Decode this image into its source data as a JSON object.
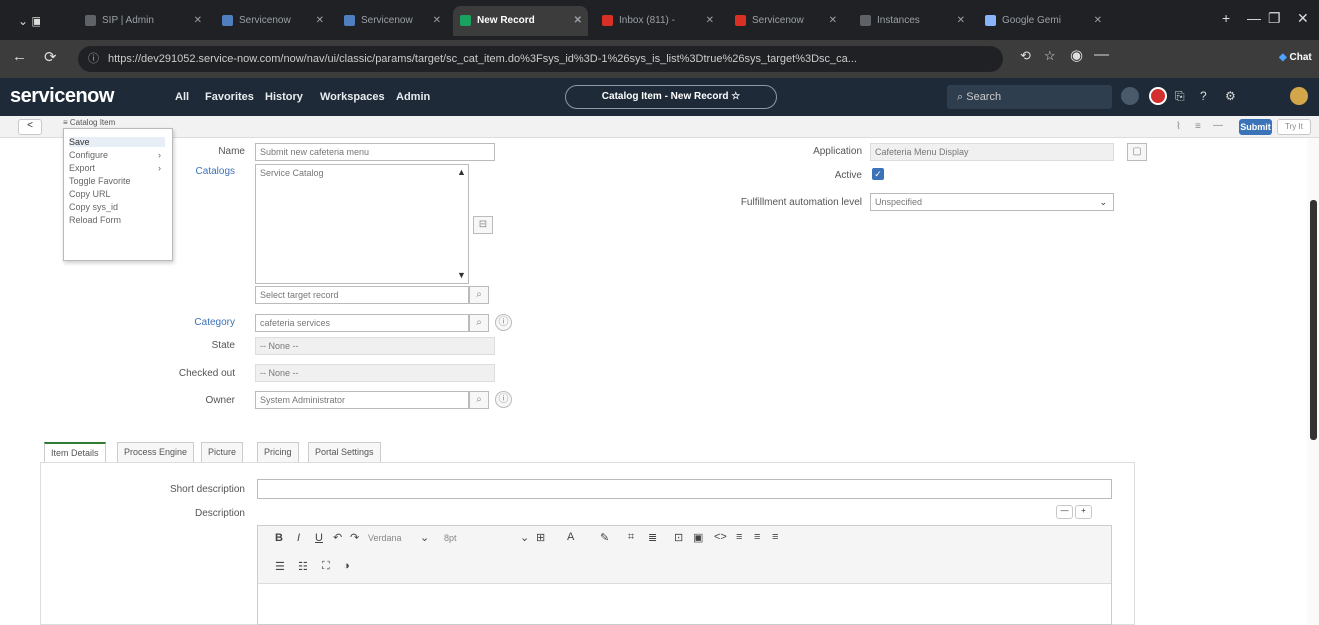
{
  "browser": {
    "tabs": [
      {
        "label": "SIP | Admin",
        "color": "#5f6368"
      },
      {
        "label": "Servicenow",
        "color": "#4f7fbf"
      },
      {
        "label": "Servicenow",
        "color": "#4f7fbf"
      },
      {
        "label": "New Record",
        "color": "#1aa260"
      },
      {
        "label": "Inbox (811) -",
        "color": "#d93025"
      },
      {
        "label": "Servicenow",
        "color": "#d93025"
      },
      {
        "label": "Instances",
        "color": "#5f6368"
      },
      {
        "label": "Google Gemi",
        "color": "#8ab4f8"
      }
    ],
    "url": "https://dev291052.service-now.com/now/nav/ui/classic/params/target/sc_cat_item.do%3Fsys_id%3D-1%26sys_is_list%3Dtrue%26sys_target%3Dsc_ca...",
    "chat_label": "Chat"
  },
  "header": {
    "logo": "servicenow",
    "nav": [
      "All",
      "Favorites",
      "History",
      "Workspaces",
      "Admin"
    ],
    "context": "Catalog Item - New Record ☆",
    "search_placeholder": "Search"
  },
  "formbar": {
    "breadcrumb": "Catalog Item",
    "submit": "Submit",
    "update": "Try It"
  },
  "context_menu": {
    "items": [
      "Save",
      "Configure",
      "Export",
      "Toggle Favorite",
      "Copy URL",
      "Copy sys_id",
      "Reload Form"
    ]
  },
  "form": {
    "name_label": "Name",
    "name_value": "Submit new cafeteria menu",
    "catalogs_label": "Catalogs",
    "catalogs_value": "Service Catalog",
    "catalogs_target_placeholder": "Select target record",
    "category_label": "Category",
    "category_value": "cafeteria services",
    "state_label": "State",
    "state_value": "-- None --",
    "checked_out_label": "Checked out",
    "checked_out_value": "-- None --",
    "owner_label": "Owner",
    "owner_value": "System Administrator",
    "application_label": "Application",
    "application_value": "Cafeteria Menu Display",
    "active_label": "Active",
    "fulfillment_label": "Fulfillment automation level",
    "fulfillment_value": "Unspecified"
  },
  "tabs": [
    "Item Details",
    "Process Engine",
    "Picture",
    "Pricing",
    "Portal Settings"
  ],
  "details": {
    "short_desc_label": "Short description",
    "description_label": "Description",
    "font_name": "Verdana",
    "font_size": "8pt"
  }
}
